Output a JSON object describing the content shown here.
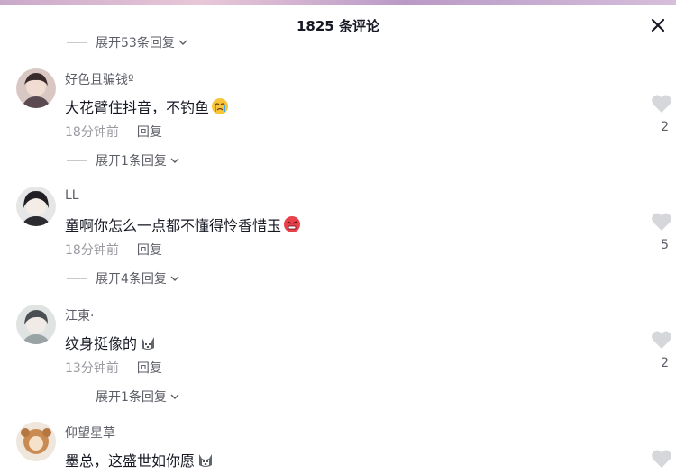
{
  "header": {
    "title": "1825 条评论"
  },
  "top_expand": {
    "label": "展开53条回复"
  },
  "comments": [
    {
      "username": "好色且骗钱º",
      "text": "大花臂住抖音，不钓鱼",
      "emoji": "crying-face-emoji",
      "time": "18分钟前",
      "reply": "回复",
      "likes": "2",
      "expand": "展开1条回复"
    },
    {
      "username": "LL",
      "text": "童啊你怎么一点都不懂得怜香惜玉",
      "emoji": "angry-face-emoji",
      "time": "18分钟前",
      "reply": "回复",
      "likes": "5",
      "expand": "展开4条回复"
    },
    {
      "username": "江東·",
      "text": "纹身挺像的",
      "emoji": "husky-emoji",
      "time": "13分钟前",
      "reply": "回复",
      "likes": "2",
      "expand": "展开1条回复"
    },
    {
      "username": "仰望星草",
      "text": "墨总，这盛世如你愿",
      "emoji": "husky-emoji",
      "time": "",
      "reply": "",
      "likes": "",
      "expand": ""
    }
  ]
}
